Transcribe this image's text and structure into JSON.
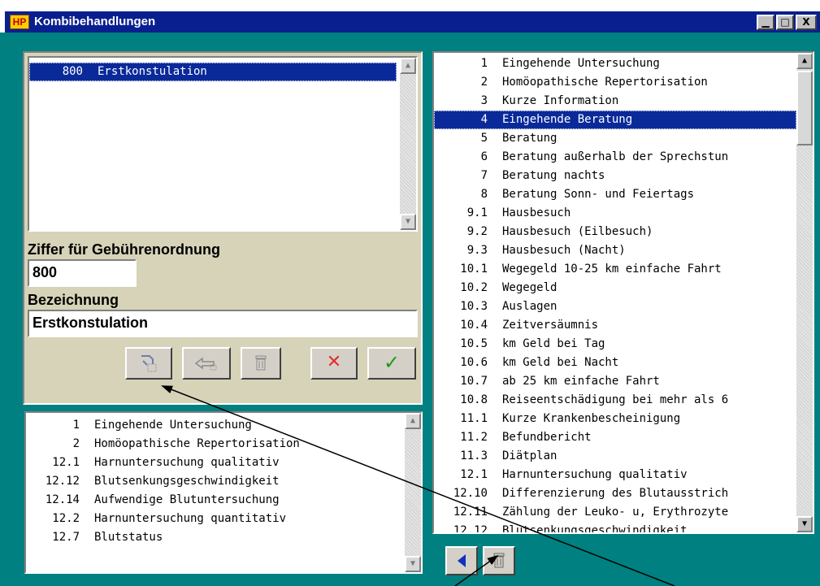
{
  "window": {
    "app_icon": "HP",
    "title": "Kombibehandlungen",
    "controls": {
      "minimize": "▁",
      "maximize": "□",
      "close": "X"
    }
  },
  "selected_list": {
    "items": [
      {
        "num": "800",
        "label": "Erstkonstulation",
        "selected": true
      }
    ]
  },
  "form": {
    "code_label": "Ziffer für Gebührenordnung",
    "code_value": "800",
    "name_label": "Bezeichnung",
    "name_value": "Erstkonstulation"
  },
  "actions": {
    "new_icon": "new-entry-icon",
    "edit_icon": "edit-pointer-icon",
    "delete_icon": "trash-icon",
    "cancel_label": "✕",
    "confirm_label": "✓"
  },
  "components_list": {
    "items": [
      {
        "num": "1",
        "label": "Eingehende Untersuchung"
      },
      {
        "num": "2",
        "label": "Homöopathische Repertorisation"
      },
      {
        "num": "12.1",
        "label": "Harnuntersuchung qualitativ"
      },
      {
        "num": "12.12",
        "label": "Blutsenkungsgeschwindigkeit"
      },
      {
        "num": "12.14",
        "label": "Aufwendige Blutuntersuchung"
      },
      {
        "num": "12.2",
        "label": "Harnuntersuchung quantitativ"
      },
      {
        "num": "12.7",
        "label": "Blutstatus"
      }
    ]
  },
  "catalog_list": {
    "items": [
      {
        "num": "1",
        "label": "Eingehende Untersuchung"
      },
      {
        "num": "2",
        "label": "Homöopathische Repertorisation"
      },
      {
        "num": "3",
        "label": "Kurze Information"
      },
      {
        "num": "4",
        "label": "Eingehende Beratung",
        "selected": true
      },
      {
        "num": "5",
        "label": "Beratung"
      },
      {
        "num": "6",
        "label": "Beratung außerhalb der Sprechstun"
      },
      {
        "num": "7",
        "label": "Beratung nachts"
      },
      {
        "num": "8",
        "label": "Beratung Sonn- und Feiertags"
      },
      {
        "num": "9.1",
        "label": "Hausbesuch"
      },
      {
        "num": "9.2",
        "label": "Hausbesuch (Eilbesuch)"
      },
      {
        "num": "9.3",
        "label": "Hausbesuch (Nacht)"
      },
      {
        "num": "10.1",
        "label": "Wegegeld 10-25 km einfache Fahrt"
      },
      {
        "num": "10.2",
        "label": "Wegegeld"
      },
      {
        "num": "10.3",
        "label": "Auslagen"
      },
      {
        "num": "10.4",
        "label": "Zeitversäumnis"
      },
      {
        "num": "10.5",
        "label": "km Geld bei Tag"
      },
      {
        "num": "10.6",
        "label": "km Geld bei Nacht"
      },
      {
        "num": "10.7",
        "label": "ab 25 km einfache Fahrt"
      },
      {
        "num": "10.8",
        "label": "Reiseentschädigung bei mehr als 6"
      },
      {
        "num": "11.1",
        "label": "Kurze Krankenbescheinigung"
      },
      {
        "num": "11.2",
        "label": "Befundbericht"
      },
      {
        "num": "11.3",
        "label": "Diätplan"
      },
      {
        "num": "12.1",
        "label": "Harnuntersuchung qualitativ"
      },
      {
        "num": "12.10",
        "label": "Differenzierung des Blutausstrich"
      },
      {
        "num": "12.11",
        "label": "Zählung der Leuko- u, Erythrozyte"
      },
      {
        "num": "12.12",
        "label": "Blutsenkungsgeschwindigkeit"
      }
    ]
  },
  "bottom_actions": {
    "add_icon": "triangle-left-icon",
    "delete_icon": "trash-icon"
  },
  "colors": {
    "window_bg": "#008080",
    "panel_bg": "#d6d3b8",
    "selection": "#0a2a9a",
    "titlebar": "#0a1f8f"
  }
}
